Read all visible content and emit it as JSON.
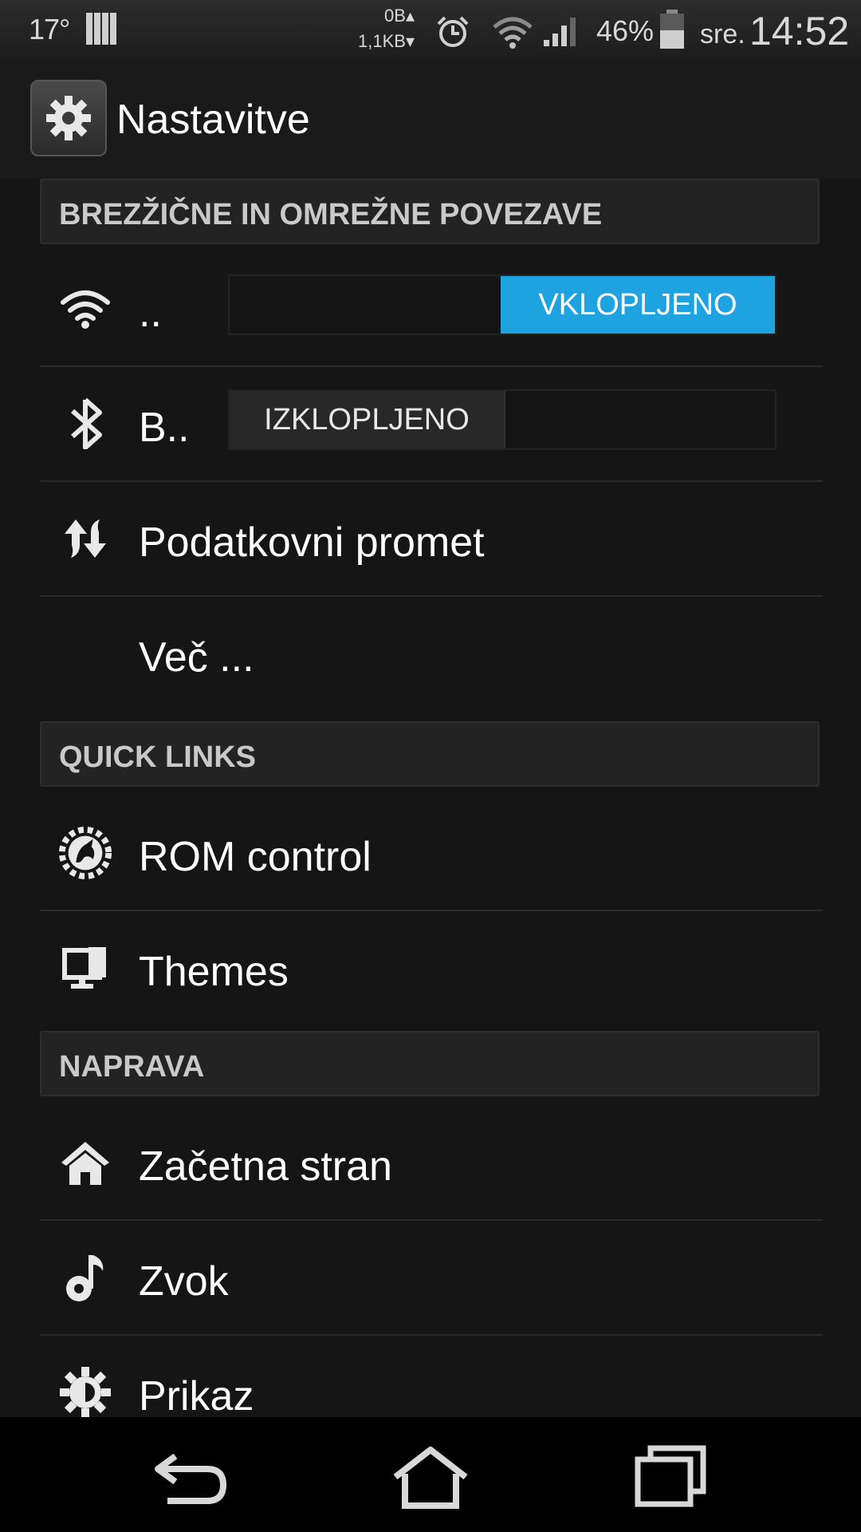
{
  "status_bar": {
    "temperature": "17°",
    "traffic_up": "0B▴",
    "traffic_down": "1,1KB▾",
    "battery_percent": "46%",
    "day": "sre.",
    "time": "14:52",
    "icons": [
      "signal-bars-icon",
      "alarm-icon",
      "wifi-icon",
      "cell-signal-icon",
      "battery-icon"
    ]
  },
  "action_bar": {
    "title": "Nastavitve",
    "icon": "settings-gear-icon"
  },
  "sections": {
    "wireless": {
      "header": "BREZŽIČNE IN OMREŽNE POVEZAVE",
      "wifi": {
        "label": "..",
        "toggle": "VKLOPLJENO",
        "state": "on",
        "icon": "wifi-icon"
      },
      "bluetooth": {
        "label": "B..",
        "toggle": "IZKLOPLJENO",
        "state": "off",
        "icon": "bluetooth-icon"
      },
      "data_usage": {
        "label": "Podatkovni promet",
        "icon": "data-transfer-icon"
      },
      "more": {
        "label": "Več ..."
      }
    },
    "quick_links": {
      "header": "QUICK LINKS",
      "rom_control": {
        "label": "ROM control",
        "icon": "rom-control-icon"
      },
      "themes": {
        "label": "Themes",
        "icon": "themes-icon"
      }
    },
    "device": {
      "header": "NAPRAVA",
      "home": {
        "label": "Začetna stran",
        "icon": "home-icon"
      },
      "sound": {
        "label": "Zvok",
        "icon": "music-note-icon"
      },
      "display": {
        "label": "Prikaz",
        "icon": "brightness-icon"
      }
    }
  },
  "nav_bar": {
    "buttons": [
      "back-icon",
      "home-icon",
      "recent-apps-icon"
    ]
  },
  "colors": {
    "accent": "#1fa3e0",
    "background": "#151515"
  }
}
